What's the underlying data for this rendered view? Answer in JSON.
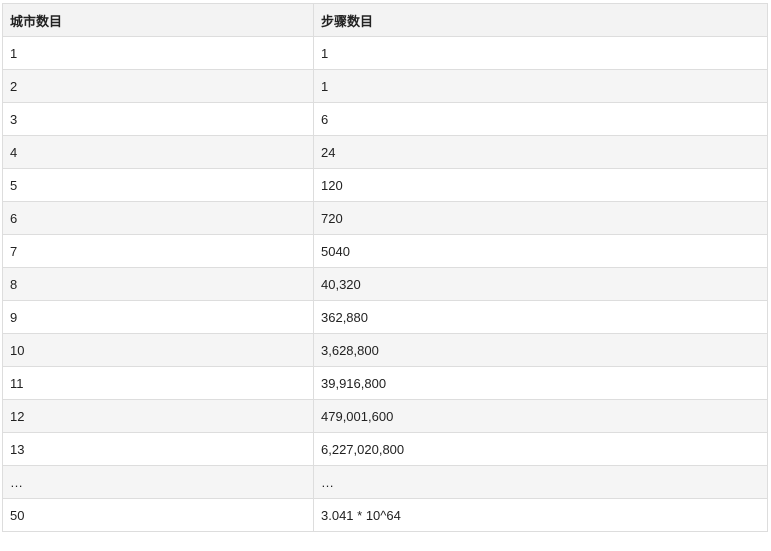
{
  "table": {
    "headers": [
      "城市数目",
      "步骤数目"
    ],
    "rows": [
      [
        "1",
        "1"
      ],
      [
        "2",
        "1"
      ],
      [
        "3",
        "6"
      ],
      [
        "4",
        "24"
      ],
      [
        "5",
        "120"
      ],
      [
        "6",
        "720"
      ],
      [
        "7",
        "5040"
      ],
      [
        "8",
        "40,320"
      ],
      [
        "9",
        "362,880"
      ],
      [
        "10",
        "3,628,800"
      ],
      [
        "11",
        "39,916,800"
      ],
      [
        "12",
        "479,001,600"
      ],
      [
        "13",
        "6,227,020,800"
      ],
      [
        "…",
        "…"
      ],
      [
        "50",
        "3.041 * 10^64"
      ]
    ]
  }
}
